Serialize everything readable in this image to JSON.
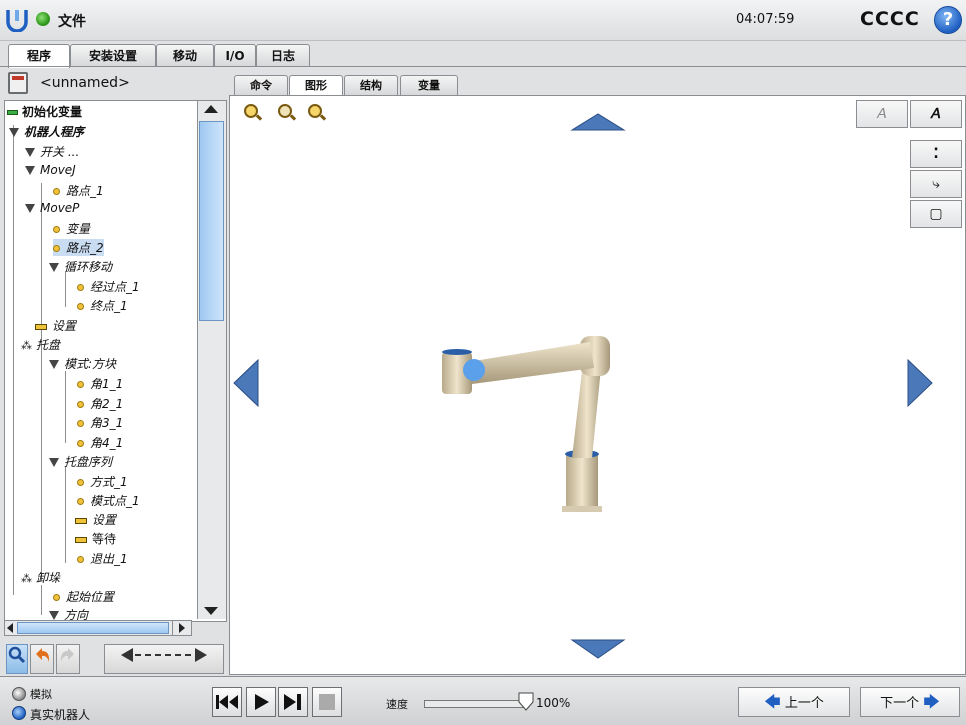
{
  "topbar": {
    "file_label": "文件",
    "clock": "04:07:59",
    "robot_name": "CCCC",
    "help_glyph": "?"
  },
  "main_tabs": [
    {
      "label": "程序",
      "active": true
    },
    {
      "label": "安装设置",
      "active": false
    },
    {
      "label": "移动",
      "active": false
    },
    {
      "label": "I/O",
      "active": false
    },
    {
      "label": "日志",
      "active": false
    }
  ],
  "program": {
    "name": "<unnamed>"
  },
  "sub_tabs": [
    {
      "label": "命令",
      "active": false
    },
    {
      "label": "图形",
      "active": true
    },
    {
      "label": "结构",
      "active": false
    },
    {
      "label": "变量",
      "active": false
    }
  ],
  "tree": {
    "init_vars": "初始化变量",
    "robot_program": "机器人程序",
    "switch": "开关 ...",
    "movej": "MoveJ",
    "wp1": "路点_1",
    "movep": "MoveP",
    "var": "变量",
    "wp2": "路点_2",
    "circle_move": "循环移动",
    "via": "经过点_1",
    "end": "终点_1",
    "set1": "设置",
    "pallet": "托盘",
    "pattern": "模式:方块",
    "c1": "角1_1",
    "c2": "角2_1",
    "c3": "角3_1",
    "c4": "角4_1",
    "pallet_seq": "托盘序列",
    "approach": "方式_1",
    "pattern_pt": "模式点_1",
    "set2": "设置",
    "wait": "等待",
    "exit": "退出_1",
    "unload": "卸垛",
    "start_pos": "起始位置",
    "direction": "方向"
  },
  "bottom": {
    "sim_label": "模拟",
    "real_label": "真实机器人",
    "speed_label": "速度",
    "speed_value": "100%",
    "speed_fraction": 1.0,
    "prev_label": "上一个",
    "next_label": "下一个"
  },
  "colors": {
    "accent": "#1f5fc2",
    "status_green": "#2f9a1c",
    "tab_blue": "#8cbce8"
  }
}
